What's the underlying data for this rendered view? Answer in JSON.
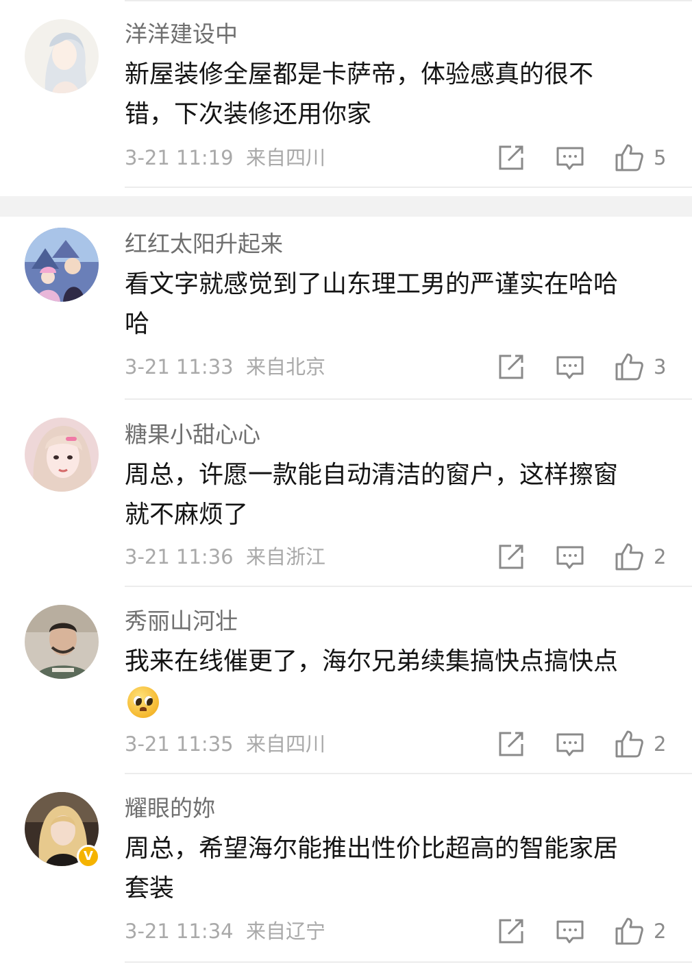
{
  "comments": [
    {
      "username": "洋洋建设中",
      "lines": [
        "新屋装修全屋都是卡萨帝，体验感真的很不",
        "错，下次装修还用你家"
      ],
      "time": "3-21 11:19",
      "location": "来自四川",
      "likes": "5",
      "verified": false
    },
    {
      "username": "红红太阳升起来",
      "lines": [
        "看文字就感觉到了山东理工男的严谨实在哈哈",
        "哈"
      ],
      "time": "3-21 11:33",
      "location": "来自北京",
      "likes": "3",
      "verified": false
    },
    {
      "username": "糖果小甜心心",
      "lines": [
        "周总，许愿一款能自动清洁的窗户，这样擦窗",
        "就不麻烦了"
      ],
      "time": "3-21 11:36",
      "location": "来自浙江",
      "likes": "2",
      "verified": false
    },
    {
      "username": "秀丽山河壮",
      "lines": [
        "我来在线催更了，海尔兄弟续集搞快点搞快点",
        ""
      ],
      "time": "3-21 11:35",
      "location": "来自四川",
      "likes": "2",
      "verified": false,
      "emoji": "pleading-face"
    },
    {
      "username": "耀眼的妳",
      "lines": [
        "周总，希望海尔能推出性价比超高的智能家居",
        "套装"
      ],
      "time": "3-21 11:34",
      "location": "来自辽宁",
      "likes": "2",
      "verified": true,
      "badge": "V"
    }
  ],
  "colors": {
    "username": "#6f6f6f",
    "text": "#141414",
    "meta": "#a9a9a9",
    "divider": "#ececec",
    "section_gap": "#f2f2f2",
    "verified_badge": "#f5b300"
  }
}
